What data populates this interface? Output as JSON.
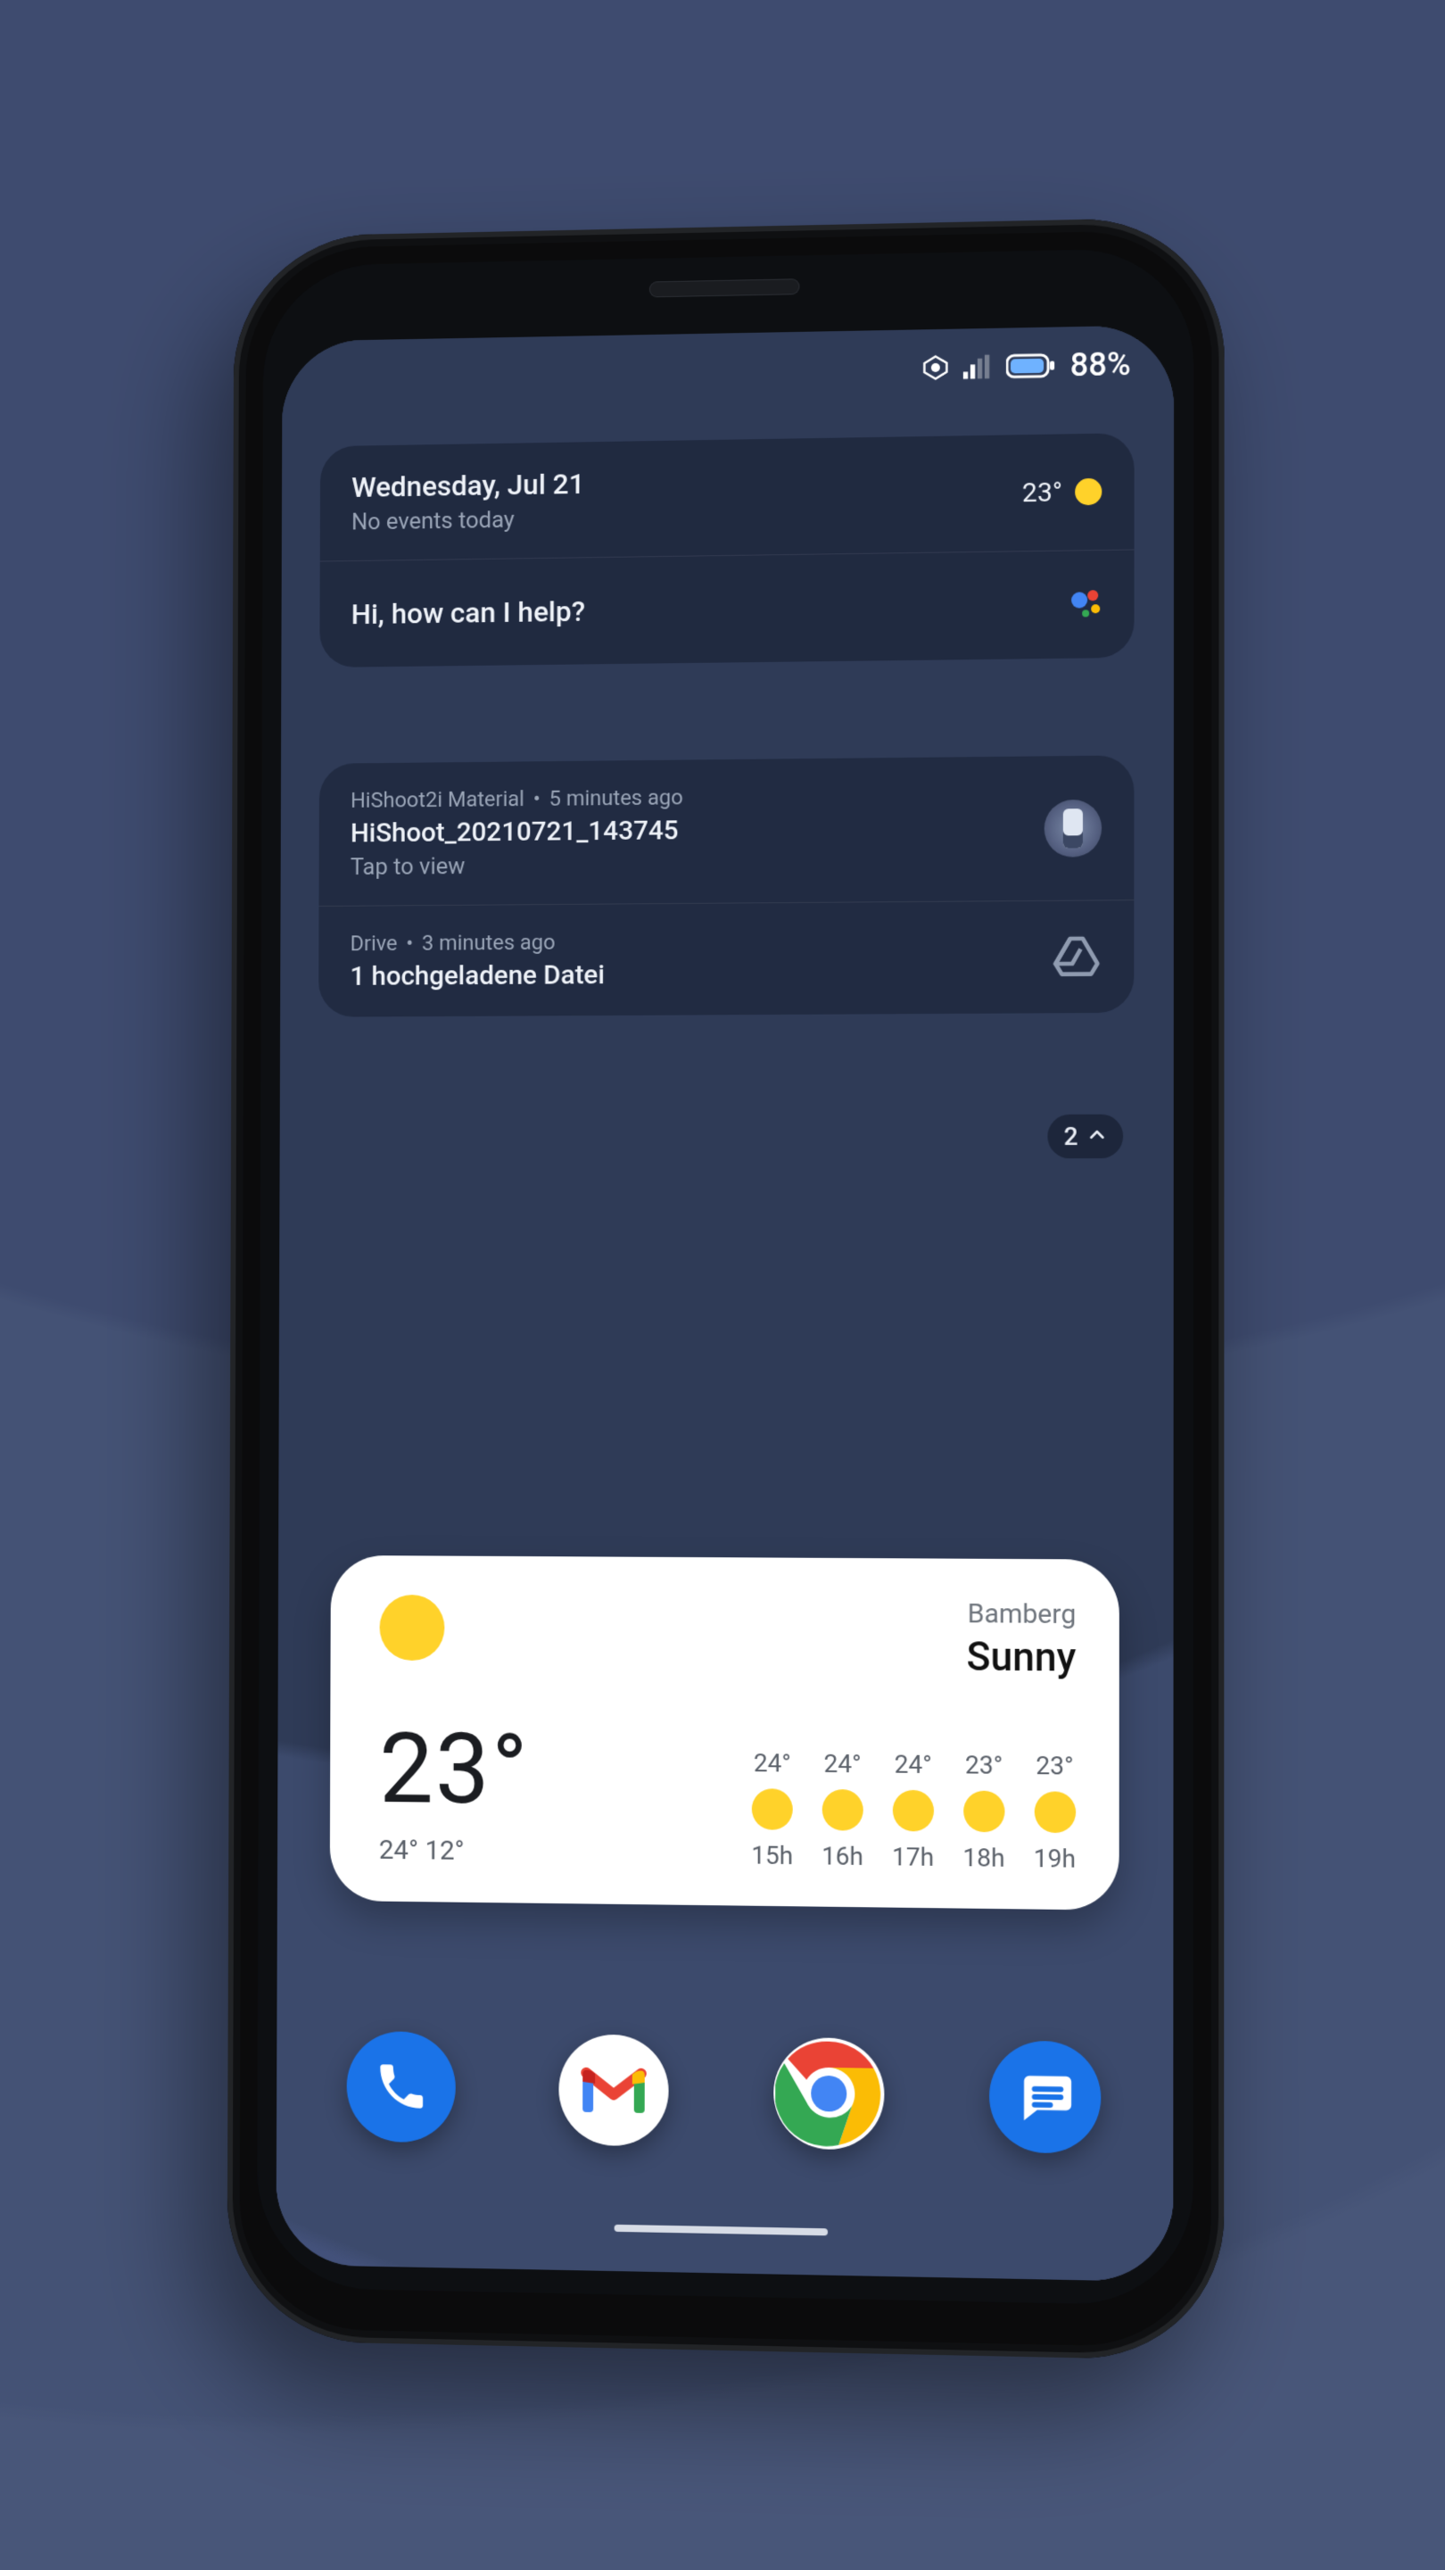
{
  "statusbar": {
    "battery_text": "88%"
  },
  "glance": {
    "date": "Wednesday, Jul 21",
    "events": "No events today",
    "temp": "23°"
  },
  "assistant": {
    "prompt": "Hi, how can I help?"
  },
  "notifications": [
    {
      "app": "HiShoot2i Material",
      "age": "5 minutes ago",
      "title": "HiShoot_20210721_143745",
      "subtitle": "Tap to view"
    },
    {
      "app": "Drive",
      "age": "3 minutes ago",
      "title": "1 hochgeladene Datei",
      "subtitle": ""
    }
  ],
  "overflow": {
    "count": "2"
  },
  "weather": {
    "city": "Bamberg",
    "condition": "Sunny",
    "temp": "23°",
    "high": "24°",
    "low": "12°",
    "forecast": [
      {
        "temp": "24°",
        "hour": "15h"
      },
      {
        "temp": "24°",
        "hour": "16h"
      },
      {
        "temp": "24°",
        "hour": "17h"
      },
      {
        "temp": "23°",
        "hour": "18h"
      },
      {
        "temp": "23°",
        "hour": "19h"
      }
    ]
  },
  "dock": {
    "phone": "Phone",
    "gmail": "Gmail",
    "chrome": "Chrome",
    "messages": "Messages"
  }
}
